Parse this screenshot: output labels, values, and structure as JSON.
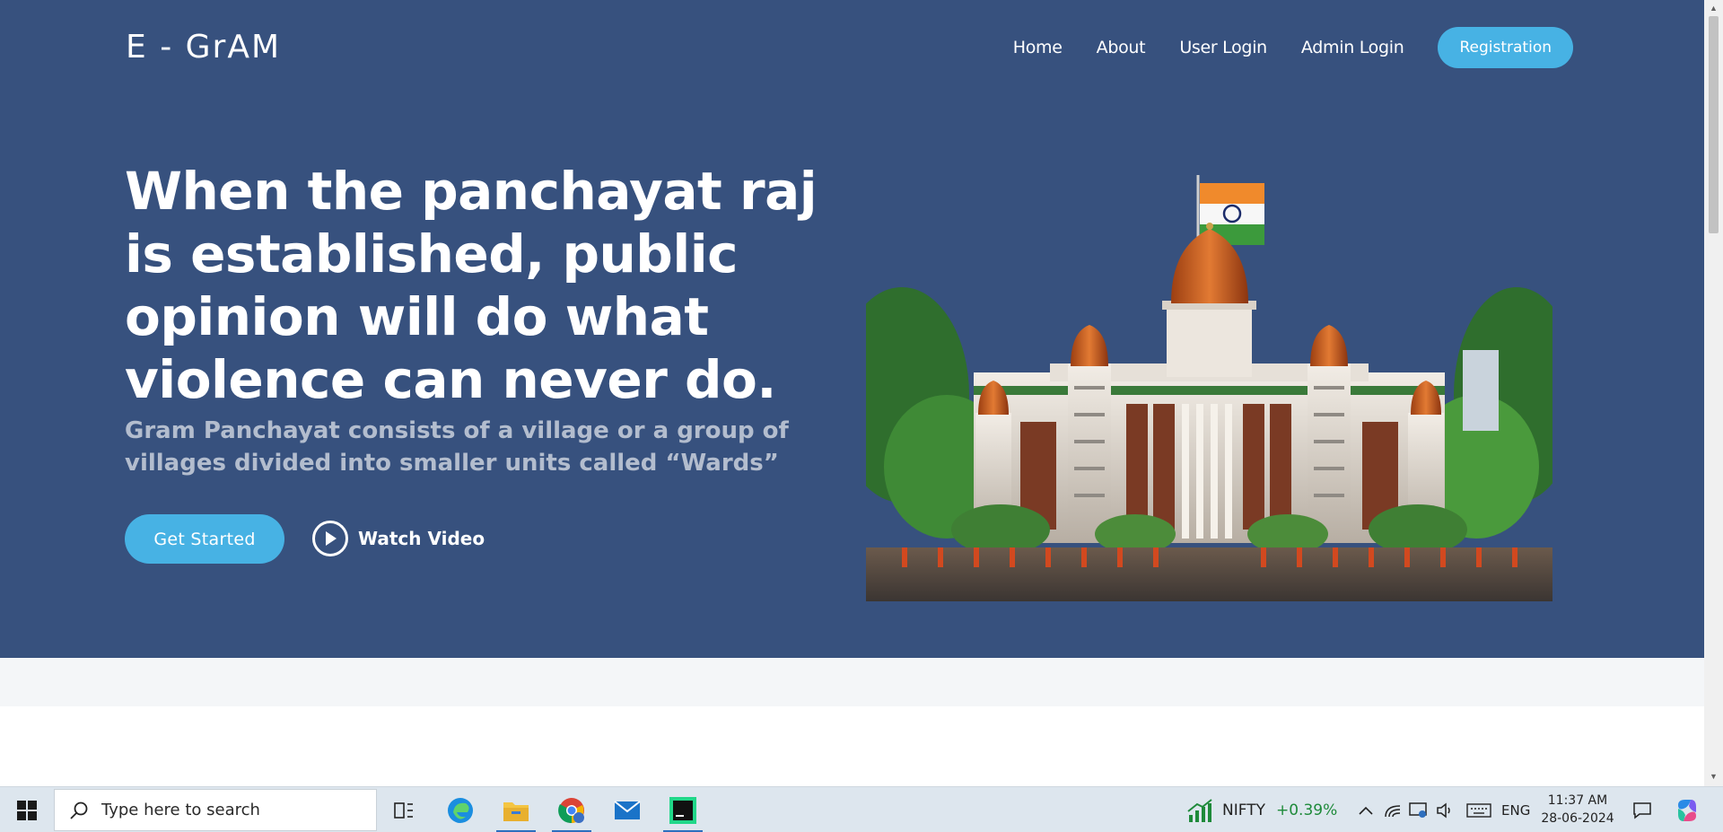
{
  "header": {
    "logo": "E - GrAM",
    "nav": {
      "home": "Home",
      "about": "About",
      "user_login": "User Login",
      "admin_login": "Admin Login",
      "registration": "Registration"
    }
  },
  "hero": {
    "headline": "When the panchayat raj is established, public opinion will do what violence can never do.",
    "subheadline": "Gram Panchayat consists of a village or a group of villages divided into smaller units called “Wards”",
    "get_started": "Get Started",
    "watch_video": "Watch Video"
  },
  "taskbar": {
    "search_placeholder": "Type here to search",
    "stock_name": "NIFTY",
    "stock_change": "+0.39%",
    "language": "ENG",
    "time": "11:37 AM",
    "date": "28-06-2024"
  },
  "colors": {
    "hero_bg": "#37517e",
    "accent": "#47b2e4",
    "strip_bg": "#f4f6f8",
    "taskbar_bg": "#dde6ee",
    "stock_up": "#1e8a3a"
  }
}
